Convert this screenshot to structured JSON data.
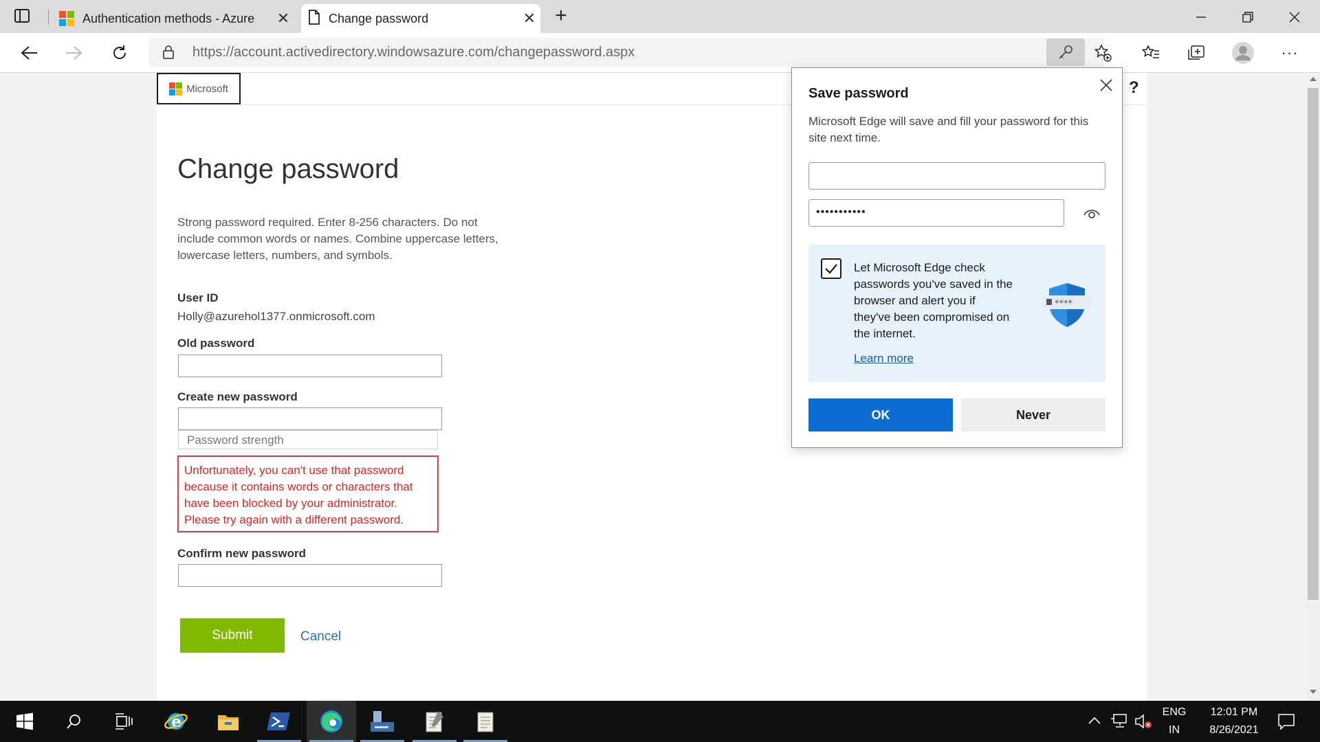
{
  "browser": {
    "tabs": [
      {
        "label": "Authentication methods - Azure",
        "active": false
      },
      {
        "label": "Change password",
        "active": true
      }
    ],
    "url_base": "https://account.activedirectory.windowsazure.com",
    "url_path": "/changepassword.aspx"
  },
  "page": {
    "logo_text": "Microsoft",
    "help_label": "?",
    "title": "Change password",
    "description": "Strong password required. Enter 8-256 characters. Do not include common words or names. Combine uppercase letters, lowercase letters, numbers, and symbols.",
    "user_id_label": "User ID",
    "user_id_value": "Holly@azurehol1377.onmicrosoft.com",
    "old_password_label": "Old password",
    "new_password_label": "Create new password",
    "strength_placeholder": "Password strength",
    "error_message": "Unfortunately, you can't use that password because it contains words or characters that have been blocked by your administrator. Please try again with a different password.",
    "confirm_password_label": "Confirm new password",
    "submit_label": "Submit",
    "cancel_label": "Cancel"
  },
  "popup": {
    "title": "Save password",
    "description": "Microsoft Edge will save and fill your password for this site next time.",
    "username_value": "",
    "password_masked": "•••••••••••",
    "monitor_checked": true,
    "monitor_text": "Let Microsoft Edge check passwords you've saved in the browser and alert you if they've been compromised on the internet.",
    "learn_more": "Learn more",
    "shield_text": "****",
    "ok_label": "OK",
    "never_label": "Never"
  },
  "taskbar": {
    "language": "ENG",
    "region": "IN",
    "time": "12:01 PM",
    "date": "8/26/2021"
  },
  "colors": {
    "submit_green": "#7fba00",
    "error_red": "#e02020",
    "ok_blue": "#0b6cd1",
    "link_blue": "#2c6fb0"
  }
}
